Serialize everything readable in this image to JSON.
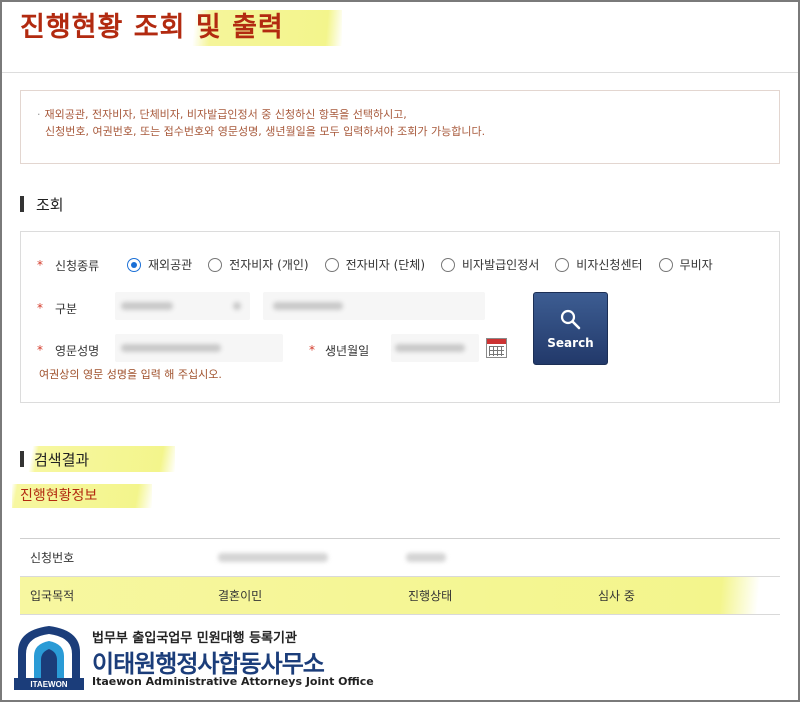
{
  "page": {
    "title": "진행현황 조회 및 출력"
  },
  "notice": {
    "bullet": "·",
    "line1": "재외공관, 전자비자, 단체비자, 비자발급인정서 중 신청하신 항목을 선택하시고,",
    "line2": "신청번호, 여권번호, 또는 접수번호와 영문성명, 생년월일을 모두 입력하셔야 조회가 가능합니다."
  },
  "search_section": {
    "heading": "조회",
    "required_mark": "*",
    "type_label": "신청종류",
    "options": [
      "재외공관",
      "전자비자 (개인)",
      "전자비자 (단체)",
      "비자발급인정서",
      "비자신청센터",
      "무비자"
    ],
    "selected_option": "재외공관",
    "category_label": "구분",
    "name_label": "영문성명",
    "birth_label": "생년월일",
    "search_button": "Search",
    "hint": "여권상의 영문 성명을 입력 해 주십시오."
  },
  "results": {
    "heading": "검색결과",
    "subheading": "진행현황정보",
    "row1": {
      "label": "신청번호"
    },
    "row2": {
      "purpose_label": "입국목적",
      "purpose_value": "결혼이민",
      "status_label": "진행상태",
      "status_value": "심사 중"
    }
  },
  "footer": {
    "org_line1": "법무부 출입국업무 민원대행 등록기관",
    "org_name": "이태원행정사합동사무소",
    "org_english": "Itaewon Administrative Attorneys Joint Office",
    "logo_text": "ITAEWON"
  },
  "colors": {
    "title": "#b22a10",
    "highlight": "#f3f58c",
    "button": "#22396a",
    "radio_selected": "#1a6fd6"
  },
  "icons": {
    "search": "magnifier-icon",
    "calendar": "calendar-icon",
    "logo": "mosque-dome-logo"
  }
}
